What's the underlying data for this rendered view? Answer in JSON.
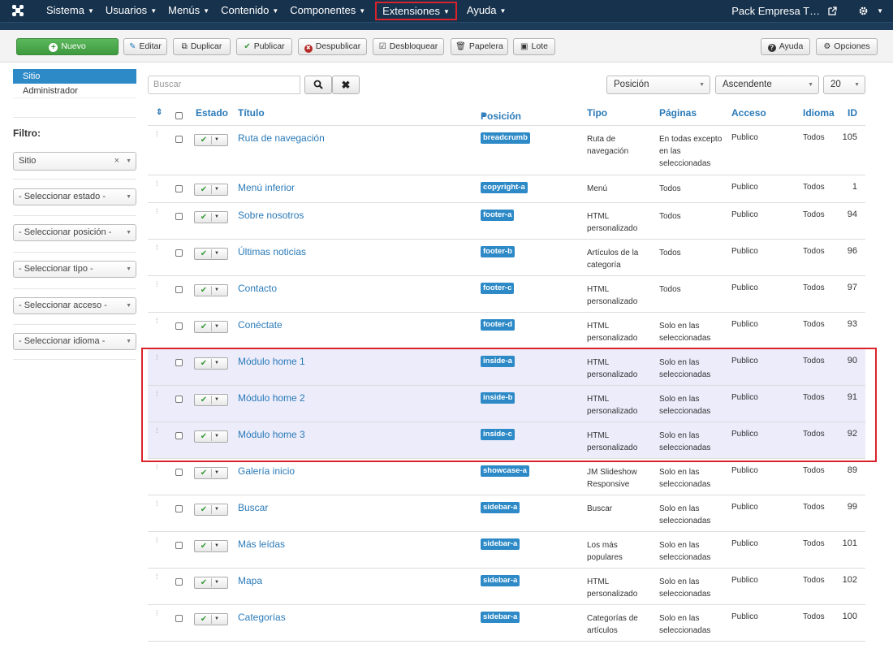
{
  "topbar": {
    "menu": [
      {
        "label": "Sistema"
      },
      {
        "label": "Usuarios"
      },
      {
        "label": "Menús"
      },
      {
        "label": "Contenido"
      },
      {
        "label": "Componentes"
      },
      {
        "label": "Extensiones",
        "highlighted": true
      },
      {
        "label": "Ayuda"
      }
    ],
    "site_label": "Pack Empresa T…",
    "external_icon": "external-link-icon",
    "settings_icon": "gear-icon"
  },
  "toolbar": {
    "nuevo": "Nuevo",
    "editar": "Editar",
    "duplicar": "Duplicar",
    "publicar": "Publicar",
    "despublicar": "Despublicar",
    "desbloquear": "Desbloquear",
    "papelera": "Papelera",
    "lote": "Lote",
    "ayuda": "Ayuda",
    "opciones": "Opciones"
  },
  "sidebar": {
    "items": [
      {
        "label": "Sitio",
        "active": true
      },
      {
        "label": "Administrador"
      }
    ],
    "filter_label": "Filtro:",
    "filters": [
      {
        "value": "Sitio"
      },
      {
        "value": "- Seleccionar estado -"
      },
      {
        "value": "- Seleccionar posición -"
      },
      {
        "value": "- Seleccionar tipo -"
      },
      {
        "value": "- Seleccionar acceso -"
      },
      {
        "value": "- Seleccionar idioma -"
      }
    ]
  },
  "search": {
    "placeholder": "Buscar",
    "sort_field": "Posición",
    "sort_order": "Ascendente",
    "limit": "20"
  },
  "table": {
    "headers": {
      "estado": "Estado",
      "titulo": "Título",
      "posicion": "Posición",
      "tipo": "Tipo",
      "paginas": "Páginas",
      "acceso": "Acceso",
      "idioma": "Idioma",
      "id": "ID"
    },
    "sort_indicator": "▲",
    "rows": [
      {
        "title": "Ruta de navegación",
        "position": "breadcrumb",
        "type": "Ruta de navegación",
        "pages": "En todas excepto en las seleccionadas",
        "access": "Publico",
        "language": "Todos",
        "id": "105"
      },
      {
        "title": "Menú inferior",
        "position": "copyright-a",
        "type": "Menú",
        "pages": "Todos",
        "access": "Publico",
        "language": "Todos",
        "id": "1"
      },
      {
        "title": "Sobre nosotros",
        "position": "footer-a",
        "type": "HTML personalizado",
        "pages": "Todos",
        "access": "Publico",
        "language": "Todos",
        "id": "94"
      },
      {
        "title": "Últimas noticias",
        "position": "footer-b",
        "type": "Artículos de la categoría",
        "pages": "Todos",
        "access": "Publico",
        "language": "Todos",
        "id": "96"
      },
      {
        "title": "Contacto",
        "position": "footer-c",
        "type": "HTML personalizado",
        "pages": "Todos",
        "access": "Publico",
        "language": "Todos",
        "id": "97"
      },
      {
        "title": "Conéctate",
        "position": "footer-d",
        "type": "HTML personalizado",
        "pages": "Solo en las seleccionadas",
        "access": "Publico",
        "language": "Todos",
        "id": "93"
      },
      {
        "title": "Módulo home 1",
        "position": "inside-a",
        "type": "HTML personalizado",
        "pages": "Solo en las seleccionadas",
        "access": "Publico",
        "language": "Todos",
        "id": "90",
        "highlighted": true
      },
      {
        "title": "Módulo home 2",
        "position": "inside-b",
        "type": "HTML personalizado",
        "pages": "Solo en las seleccionadas",
        "access": "Publico",
        "language": "Todos",
        "id": "91",
        "highlighted": true
      },
      {
        "title": "Módulo home 3",
        "position": "inside-c",
        "type": "HTML personalizado",
        "pages": "Solo en las seleccionadas",
        "access": "Publico",
        "language": "Todos",
        "id": "92",
        "highlighted": true
      },
      {
        "title": "Galería inicio",
        "position": "showcase-a",
        "type": "JM Slideshow Responsive",
        "pages": "Solo en las seleccionadas",
        "access": "Publico",
        "language": "Todos",
        "id": "89"
      },
      {
        "title": "Buscar",
        "position": "sidebar-a",
        "type": "Buscar",
        "pages": "Solo en las seleccionadas",
        "access": "Publico",
        "language": "Todos",
        "id": "99"
      },
      {
        "title": "Más leídas",
        "position": "sidebar-a",
        "type": "Los más populares",
        "pages": "Solo en las seleccionadas",
        "access": "Publico",
        "language": "Todos",
        "id": "101"
      },
      {
        "title": "Mapa",
        "position": "sidebar-a",
        "type": "HTML personalizado",
        "pages": "Solo en las seleccionadas",
        "access": "Publico",
        "language": "Todos",
        "id": "102"
      },
      {
        "title": "Categorías",
        "position": "sidebar-a",
        "type": "Categorías de artículos",
        "pages": "Solo en las seleccionadas",
        "access": "Publico",
        "language": "Todos",
        "id": "100"
      }
    ]
  },
  "colors": {
    "topbar": "#17324d",
    "accent": "#2d8ac7",
    "highlight_border": "#d9222a",
    "nuevo_button": "#4cae4c"
  }
}
